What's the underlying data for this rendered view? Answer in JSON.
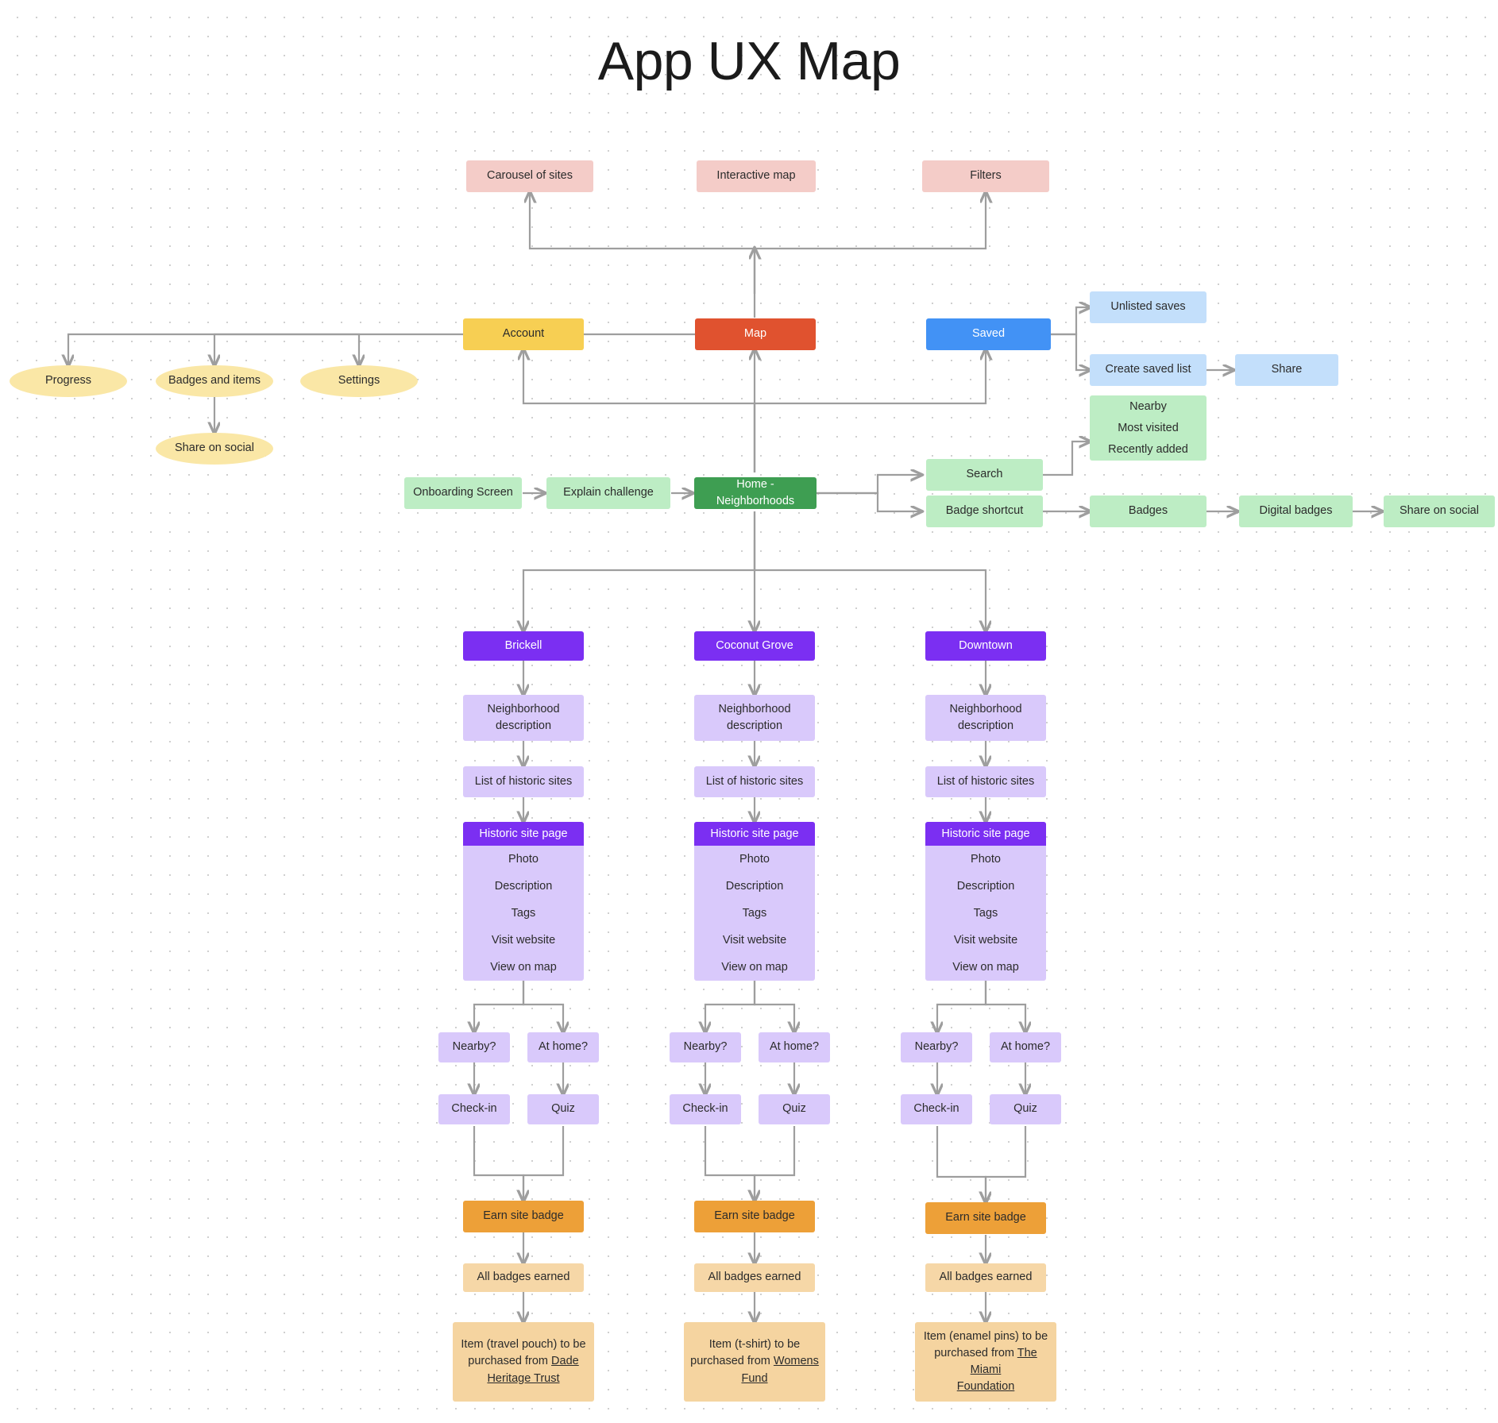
{
  "page": {
    "title": "App UX Map"
  },
  "colors": {
    "pink": "#F4CCC8",
    "yellow": "#F7CF53",
    "red": "#E0522F",
    "blue": "#4292F5",
    "blue_light": "#C3DFFB",
    "green_light": "#BDEDC4",
    "green_dark": "#3E9E52",
    "ellipse_yellow": "#FAE7A6",
    "purple": "#7B2FF2",
    "purple_light": "#D9C9FB",
    "orange": "#EDA038",
    "tan": "#F6D7A7",
    "edge": "#9e9e9e"
  },
  "top_row": {
    "carousel": "Carousel of sites",
    "interactive_map": "Interactive map",
    "filters": "Filters"
  },
  "nav_row": {
    "account": "Account",
    "map": "Map",
    "saved": "Saved"
  },
  "account_children": {
    "progress": "Progress",
    "badges_and_items": "Badges and items",
    "settings": "Settings",
    "share_on_social": "Share on social"
  },
  "saved_children": {
    "unlisted_saves": "Unlisted saves",
    "create_saved_list": "Create saved list",
    "share": "Share"
  },
  "home_row": {
    "onboarding": "Onboarding Screen",
    "explain_challenge": "Explain challenge",
    "home": "Home - Neighborhoods",
    "search": "Search",
    "badge_shortcut": "Badge shortcut"
  },
  "search_options": [
    "Nearby",
    "Most visited",
    "Recently added"
  ],
  "badge_chain": {
    "badges": "Badges",
    "digital_badges": "Digital badges",
    "share_on_social": "Share on social"
  },
  "neighborhoods": [
    {
      "name": "Brickell",
      "description": "Neighborhood description",
      "list": "List of historic sites",
      "site_page_header": "Historic site page",
      "site_page_rows": [
        "Photo",
        "Description",
        "Tags",
        "Visit website",
        "View on map"
      ],
      "nearby": "Nearby?",
      "at_home": "At home?",
      "check_in": "Check-in",
      "quiz": "Quiz",
      "earn_badge": "Earn site badge",
      "all_badges": "All badges earned",
      "item_prefix": "Item (travel pouch) to be",
      "item_mid": "purchased from ",
      "item_link_1": "Dade",
      "item_link_2": "Heritage Trust"
    },
    {
      "name": "Coconut Grove",
      "description": "Neighborhood description",
      "list": "List of historic sites",
      "site_page_header": "Historic site page",
      "site_page_rows": [
        "Photo",
        "Description",
        "Tags",
        "Visit website",
        "View on map"
      ],
      "nearby": "Nearby?",
      "at_home": "At home?",
      "check_in": "Check-in",
      "quiz": "Quiz",
      "earn_badge": "Earn site badge",
      "all_badges": "All badges earned",
      "item_prefix": "Item (t-shirt) to be",
      "item_mid": "purchased from ",
      "item_link_1": "Womens",
      "item_link_2": "Fund"
    },
    {
      "name": "Downtown",
      "description": "Neighborhood description",
      "list": "List of historic sites",
      "site_page_header": "Historic site page",
      "site_page_rows": [
        "Photo",
        "Description",
        "Tags",
        "Visit website",
        "View on map"
      ],
      "nearby": "Nearby?",
      "at_home": "At home?",
      "check_in": "Check-in",
      "quiz": "Quiz",
      "earn_badge": "Earn site badge",
      "all_badges": "All badges earned",
      "item_prefix": "Item (enamel pins) to be",
      "item_mid": "purchased from ",
      "item_link_1": "The Miami",
      "item_link_2": "Foundation"
    }
  ]
}
